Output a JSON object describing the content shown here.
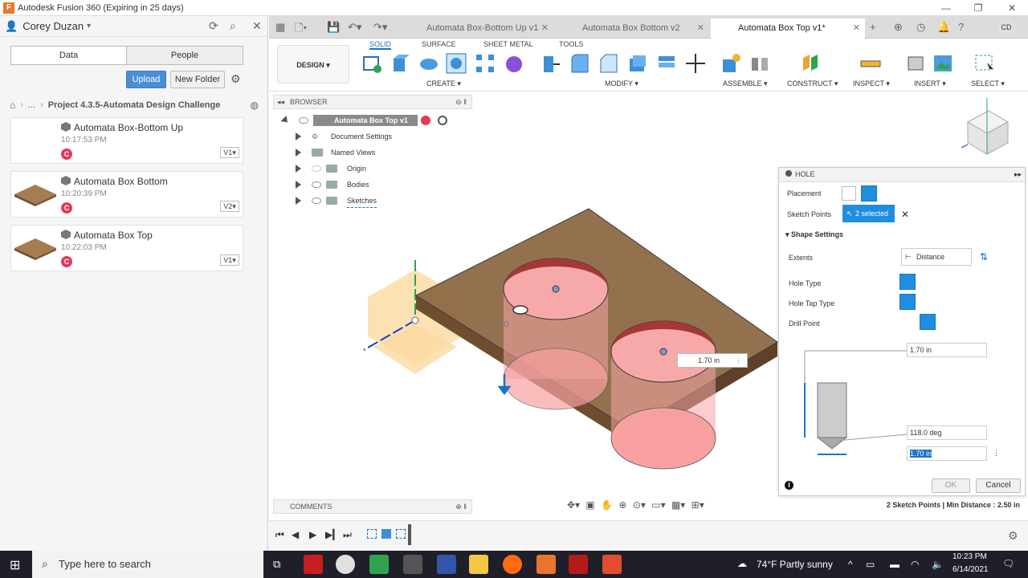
{
  "window": {
    "title": "Autodesk Fusion 360 (Expiring in 25 days)",
    "app_icon_letter": "F"
  },
  "left_panel": {
    "user": "Corey Duzan",
    "tabs": [
      "Data",
      "People"
    ],
    "upload_label": "Upload",
    "new_folder_label": "New Folder",
    "breadcrumb_ellipsis": "...",
    "breadcrumb_project": "Project 4.3.5-Automata Design Challenge",
    "items": [
      {
        "name": "Automata Box-Bottom Up",
        "time": "10:17:53 PM",
        "version": "V1",
        "badge": "C"
      },
      {
        "name": "Automata Box Bottom",
        "time": "10:20:39 PM",
        "version": "V2",
        "badge": "C"
      },
      {
        "name": "Automata Box Top",
        "time": "10:22:03 PM",
        "version": "V1",
        "badge": "C"
      }
    ]
  },
  "doc_tabs": [
    {
      "label": "Automata Box-Bottom Up v1",
      "active": false
    },
    {
      "label": "Automata Box Bottom v2",
      "active": false
    },
    {
      "label": "Automata Box Top v1*",
      "active": true
    }
  ],
  "user_initials": "CD",
  "toolbar": {
    "workspace": "DESIGN",
    "tabs": [
      "SOLID",
      "SURFACE",
      "SHEET METAL",
      "TOOLS"
    ],
    "groups": [
      "CREATE",
      "MODIFY",
      "ASSEMBLE",
      "CONSTRUCT",
      "INSPECT",
      "INSERT",
      "SELECT"
    ]
  },
  "browser": {
    "header": "BROWSER",
    "root": "Automata Box Top v1",
    "items": [
      "Document Settings",
      "Named Views",
      "Origin",
      "Bodies",
      "Sketches"
    ]
  },
  "viewport": {
    "dimension_label": "1.70 in",
    "ghost_label": "1.70"
  },
  "hole": {
    "header": "HOLE",
    "placement_label": "Placement",
    "sketch_points_label": "Sketch Points",
    "selected_label": "2 selected",
    "shape_settings": "Shape Settings",
    "extents_label": "Extents",
    "extents_value": "Distance",
    "hole_type": "Hole Type",
    "hole_tap_type": "Hole Tap Type",
    "drill_point": "Drill Point",
    "diameter": "1.70 in",
    "angle": "118.0 deg",
    "depth": "1.70 in",
    "ok": "OK",
    "cancel": "Cancel"
  },
  "comments_label": "COMMENTS",
  "status_message": "2 Sketch Points | Min Distance : 2.50 in",
  "taskbar": {
    "search_placeholder": "Type here to search",
    "weather": "74°F  Partly sunny",
    "time": "10:23 PM",
    "date": "6/14/2021"
  }
}
